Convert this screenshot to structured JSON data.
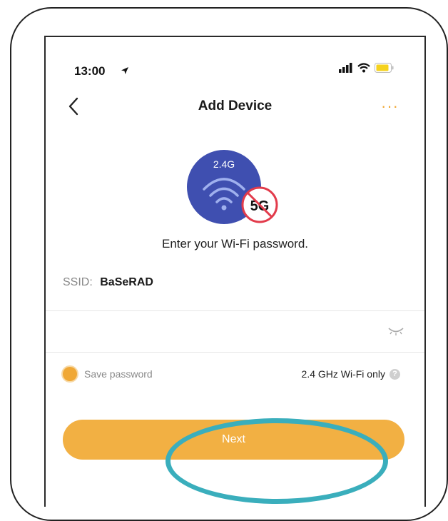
{
  "status_bar": {
    "time": "13:00"
  },
  "header": {
    "title": "Add Device",
    "more": "···"
  },
  "illustration": {
    "band_supported": "2.4G",
    "band_unsupported": "5G"
  },
  "main": {
    "prompt": "Enter your Wi-Fi password.",
    "ssid_label": "SSID:",
    "ssid_value": "BaSeRAD",
    "save_password_label": "Save password",
    "wifi_note": "2.4 GHz Wi-Fi only",
    "next_label": "Next"
  },
  "icons": {
    "back": "chevron-left-icon",
    "location": "location-arrow-icon",
    "signal": "cellular-signal-icon",
    "wifi": "wifi-icon",
    "battery": "battery-icon",
    "eye": "eye-closed-icon",
    "help": "question-icon"
  },
  "colors": {
    "accent": "#f2b043",
    "highlight": "#3aaebc",
    "illustration": "#3f4fb0",
    "no_5g": "#e23b4b"
  }
}
